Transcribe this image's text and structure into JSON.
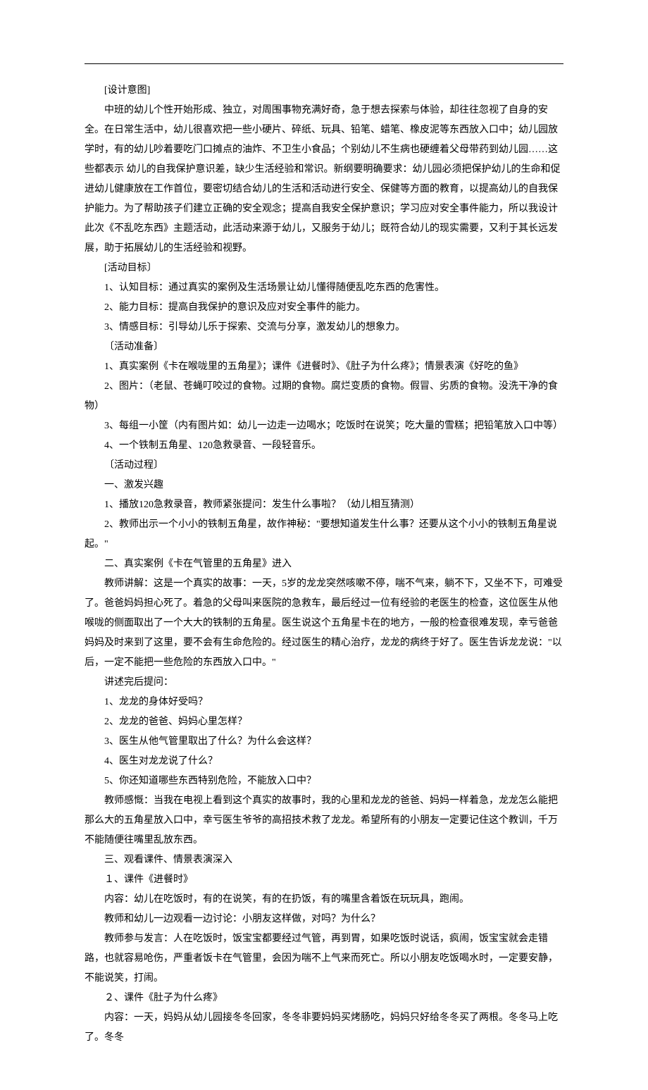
{
  "p": [
    "[设计意图]",
    "中班的幼儿个性开始形成、独立，对周围事物充满好奇，急于想去探索与体验，却往往忽视了自身的安全。在日常生活中，幼儿很喜欢把一些小硬片、碎纸、玩具、铅笔、蜡笔、橡皮泥等东西放入口中；幼儿园放学时，有的幼儿吵着要吃门口摊点的油炸、不卫生小食品；个别幼儿不生病也硬缠着父母带药到幼儿园……这些都表示 幼儿的自我保护意识差，缺少生活经验和常识。新纲要明确要求：幼儿园必须把保护幼儿的生命和促进幼儿健康放在工作首位，要密切结合幼儿的生活和活动进行安全、保健等方面的教育，以提高幼儿的自我保护能力。为了帮助孩子们建立正确的安全观念；提高自我安全保护意识；学习应对安全事件能力，所以我设计此次《不乱吃东西》主题活动，此活动来源于幼儿，又服务于幼儿；既符合幼儿的现实需要，又利于其长远发展，助于拓展幼儿的生活经验和视野。",
    "[活动目标〕",
    "1、认知目标：通过真实的案例及生活场景让幼儿懂得随便乱吃东西的危害性。",
    "2、能力目标：提高自我保护的意识及应对安全事件的能力。",
    "3、情感目标：引导幼儿乐于探索、交流与分享，激发幼儿的想象力。",
    "〔活动准备〕",
    "1、真实案例《卡在喉咙里的五角星》；课件《进餐时》、《肚子为什么疼》；情景表演《好吃的鱼》",
    "2、图片：（老鼠、苍蝇叮咬过的食物。过期的食物。腐烂变质的食物。假冒、劣质的食物。没洗干净的食物）",
    "3、每组一小筐（内有图片如：幼儿一边走一边喝水；吃饭时在说笑；吃大量的雪糕；把铅笔放入口中等）",
    "4、一个铁制五角星、120急救录音、一段轻音乐。",
    "〔活动过程〕",
    "一、激发兴趣",
    "1、播放120急救录音，教师紧张提问：发生什么事啦？（幼儿相互猜测）",
    "2、教师出示一个小小的铁制五角星，故作神秘：\"要想知道发生什么事？还要从这个小小的铁制五角星说起。\"",
    "二、真实案例《卡在气管里的五角星》进入",
    "教师讲解：这是一个真实的故事：一天，5岁的龙龙突然咳嗽不停，喘不气来，躺不下，又坐不下，可难受了。爸爸妈妈担心死了。着急的父母叫来医院的急救车，最后经过一位有经验的老医生的检查，这位医生从他喉咙的侧面取出了一个大大的铁制的五角星。医生说这个五角星卡在的地方，一般的检查很难发现，幸亏爸爸妈妈及时来到了这里，要不会有生命危险的。经过医生的精心治疗，龙龙的病终于好了。医生告诉龙龙说：\"以后，一定不能把一些危险的东西放入口中。\"",
    "讲述完后提问：",
    "1、龙龙的身体好受吗？",
    "2、龙龙的爸爸、妈妈心里怎样？",
    "3、医生从他气管里取出了什么？为什么会这样？",
    "4、医生对龙龙说了什么？",
    "5、你还知道哪些东西特别危险，不能放入口中？",
    "教师感慨：当我在电视上看到这个真实的故事时，我的心里和龙龙的爸爸、妈妈一样着急，龙龙怎么能把那么大的五角星放入口中，幸亏医生爷爷的高招技术救了龙龙。希望所有的小朋友一定要记住这个教训，千万不能随便往嘴里乱放东西。",
    "三、观看课件、情景表演深入",
    "１、课件《进餐时》",
    "内容：幼儿在吃饭时，有的在说笑，有的在扔饭，有的嘴里含着饭在玩玩具，跑闹。",
    "教师和幼儿一边观看一边讨论：小朋友这样做，对吗？为什么？",
    "教师参与发言：人在吃饭时，饭宝宝都要经过气管，再到胃，如果吃饭时说话，疯闹，饭宝宝就会走错路，也就容易呛伤，严重者饭卡在气管里，会因为喘不上气来而死亡。所以小朋友吃饭喝水时，一定要安静，不能说笑，打闹。",
    "２、课件《肚子为什么疼》",
    "内容：一天，妈妈从幼儿园接冬冬回家，冬冬非要妈妈买烤肠吃，妈妈只好给冬冬买了两根。冬冬马上吃了。冬冬"
  ]
}
